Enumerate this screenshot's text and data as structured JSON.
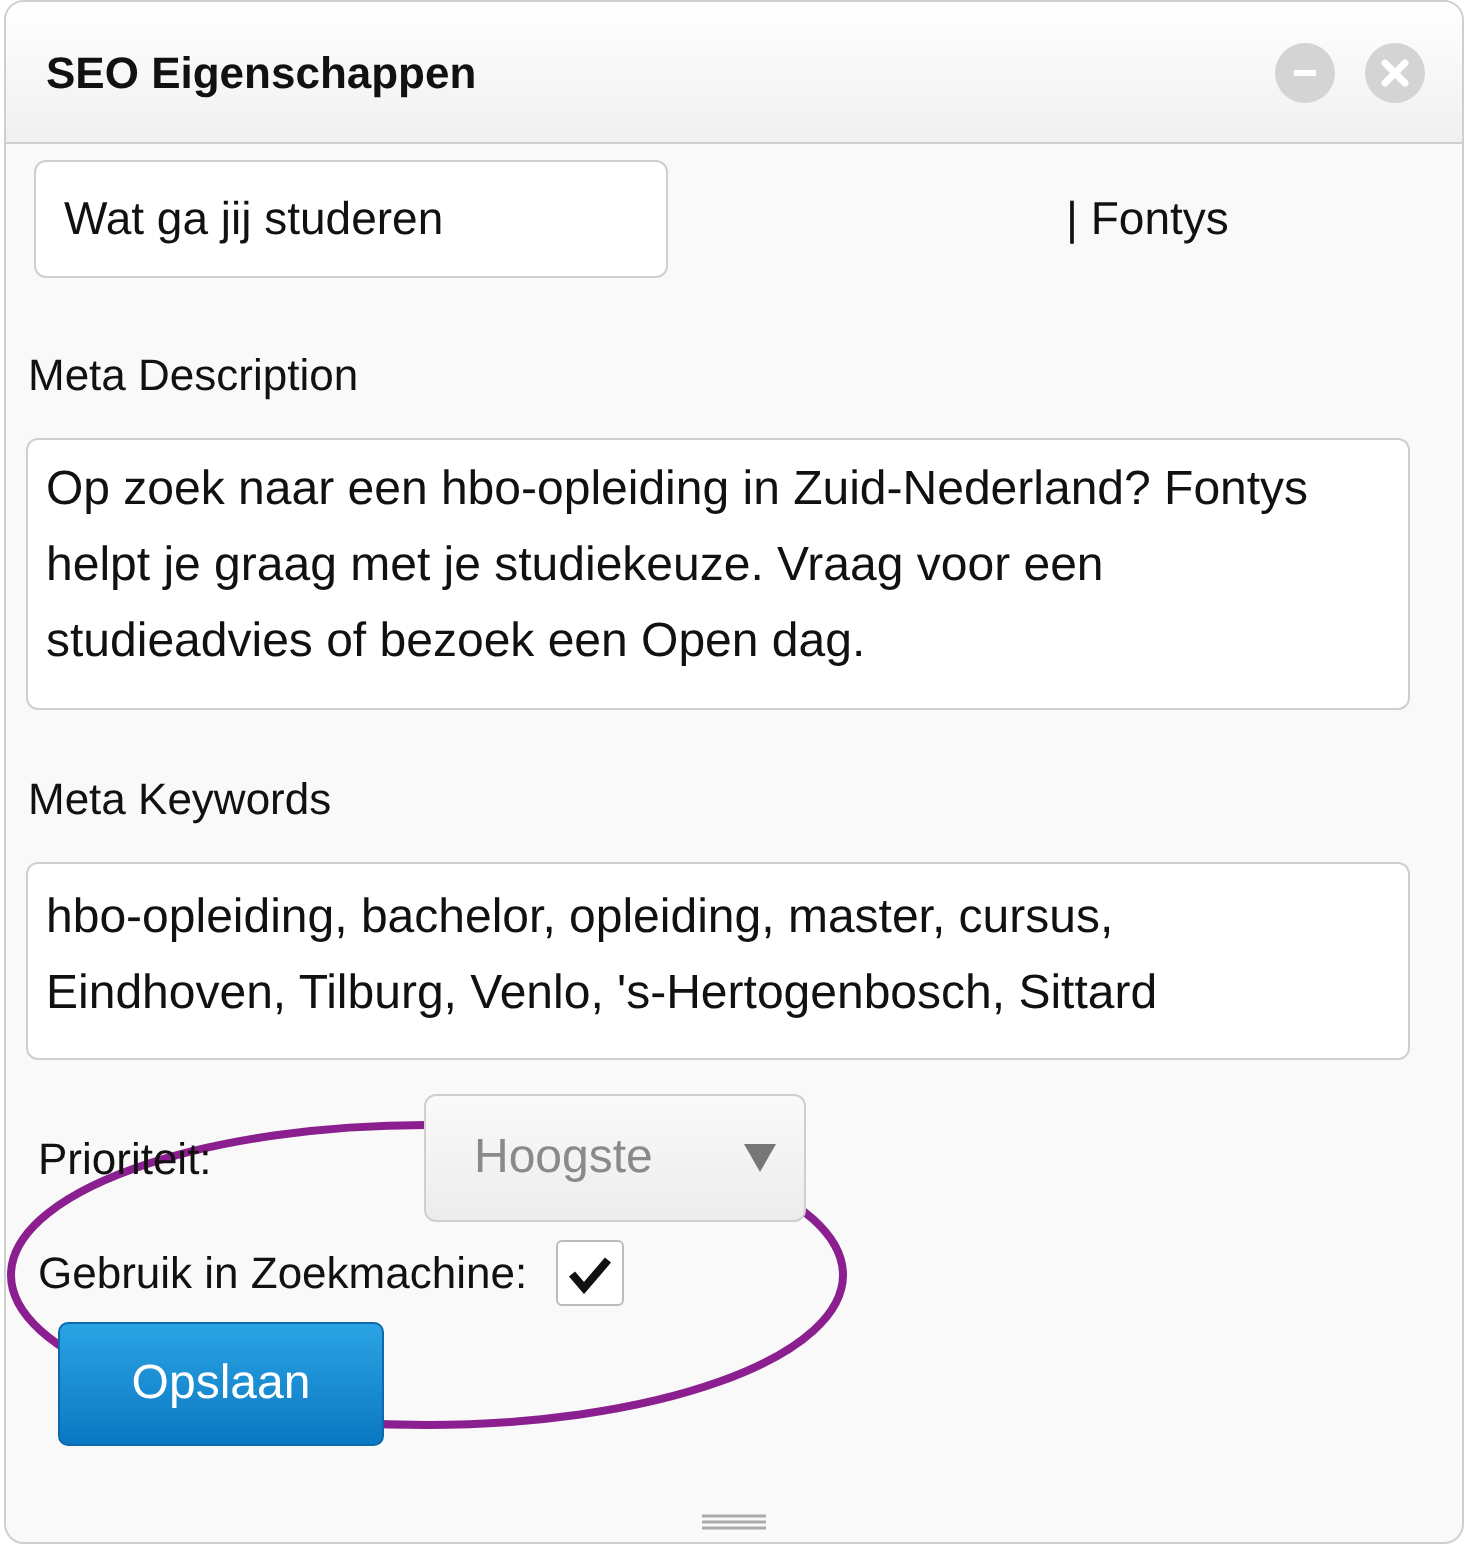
{
  "window": {
    "title": "SEO Eigenschappen"
  },
  "title_field": {
    "value": "Wat ga jij studeren",
    "suffix": "| Fontys"
  },
  "meta_description": {
    "label": "Meta Description",
    "value": "Op zoek naar een hbo-opleiding in Zuid-Nederland? Fontys helpt je graag met je studiekeuze. Vraag voor een studieadvies of bezoek een Open dag."
  },
  "meta_keywords": {
    "label": "Meta Keywords",
    "value": "hbo-opleiding, bachelor, opleiding, master, cursus, Eindhoven, Tilburg, Venlo, 's-Hertogenbosch, Sittard"
  },
  "priority": {
    "label": "Prioriteit:",
    "value": "Hoogste",
    "disabled": true
  },
  "search_engine": {
    "label": "Gebruik in Zoekmachine:",
    "checked": true
  },
  "save_button": {
    "label": "Opslaan"
  }
}
